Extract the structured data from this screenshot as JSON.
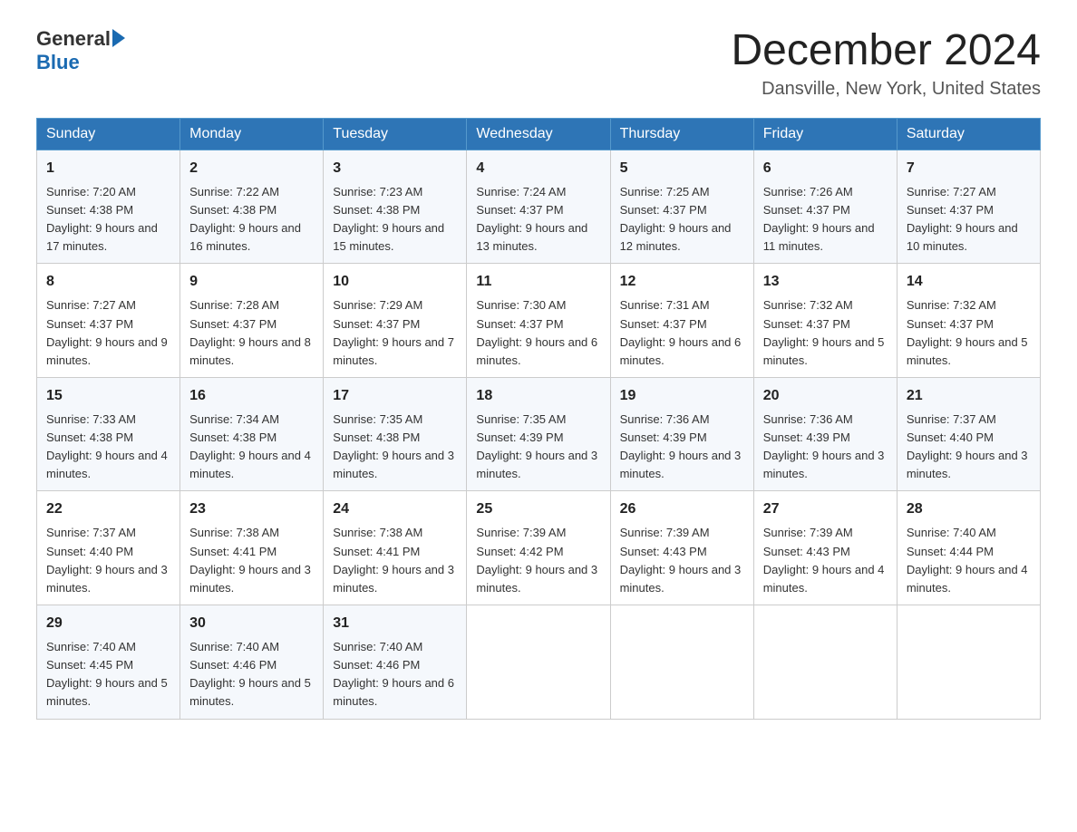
{
  "header": {
    "logo_general": "General",
    "logo_blue": "Blue",
    "month_title": "December 2024",
    "location": "Dansville, New York, United States"
  },
  "weekdays": [
    "Sunday",
    "Monday",
    "Tuesday",
    "Wednesday",
    "Thursday",
    "Friday",
    "Saturday"
  ],
  "weeks": [
    [
      {
        "day": "1",
        "sunrise": "7:20 AM",
        "sunset": "4:38 PM",
        "daylight": "9 hours and 17 minutes."
      },
      {
        "day": "2",
        "sunrise": "7:22 AM",
        "sunset": "4:38 PM",
        "daylight": "9 hours and 16 minutes."
      },
      {
        "day": "3",
        "sunrise": "7:23 AM",
        "sunset": "4:38 PM",
        "daylight": "9 hours and 15 minutes."
      },
      {
        "day": "4",
        "sunrise": "7:24 AM",
        "sunset": "4:37 PM",
        "daylight": "9 hours and 13 minutes."
      },
      {
        "day": "5",
        "sunrise": "7:25 AM",
        "sunset": "4:37 PM",
        "daylight": "9 hours and 12 minutes."
      },
      {
        "day": "6",
        "sunrise": "7:26 AM",
        "sunset": "4:37 PM",
        "daylight": "9 hours and 11 minutes."
      },
      {
        "day": "7",
        "sunrise": "7:27 AM",
        "sunset": "4:37 PM",
        "daylight": "9 hours and 10 minutes."
      }
    ],
    [
      {
        "day": "8",
        "sunrise": "7:27 AM",
        "sunset": "4:37 PM",
        "daylight": "9 hours and 9 minutes."
      },
      {
        "day": "9",
        "sunrise": "7:28 AM",
        "sunset": "4:37 PM",
        "daylight": "9 hours and 8 minutes."
      },
      {
        "day": "10",
        "sunrise": "7:29 AM",
        "sunset": "4:37 PM",
        "daylight": "9 hours and 7 minutes."
      },
      {
        "day": "11",
        "sunrise": "7:30 AM",
        "sunset": "4:37 PM",
        "daylight": "9 hours and 6 minutes."
      },
      {
        "day": "12",
        "sunrise": "7:31 AM",
        "sunset": "4:37 PM",
        "daylight": "9 hours and 6 minutes."
      },
      {
        "day": "13",
        "sunrise": "7:32 AM",
        "sunset": "4:37 PM",
        "daylight": "9 hours and 5 minutes."
      },
      {
        "day": "14",
        "sunrise": "7:32 AM",
        "sunset": "4:37 PM",
        "daylight": "9 hours and 5 minutes."
      }
    ],
    [
      {
        "day": "15",
        "sunrise": "7:33 AM",
        "sunset": "4:38 PM",
        "daylight": "9 hours and 4 minutes."
      },
      {
        "day": "16",
        "sunrise": "7:34 AM",
        "sunset": "4:38 PM",
        "daylight": "9 hours and 4 minutes."
      },
      {
        "day": "17",
        "sunrise": "7:35 AM",
        "sunset": "4:38 PM",
        "daylight": "9 hours and 3 minutes."
      },
      {
        "day": "18",
        "sunrise": "7:35 AM",
        "sunset": "4:39 PM",
        "daylight": "9 hours and 3 minutes."
      },
      {
        "day": "19",
        "sunrise": "7:36 AM",
        "sunset": "4:39 PM",
        "daylight": "9 hours and 3 minutes."
      },
      {
        "day": "20",
        "sunrise": "7:36 AM",
        "sunset": "4:39 PM",
        "daylight": "9 hours and 3 minutes."
      },
      {
        "day": "21",
        "sunrise": "7:37 AM",
        "sunset": "4:40 PM",
        "daylight": "9 hours and 3 minutes."
      }
    ],
    [
      {
        "day": "22",
        "sunrise": "7:37 AM",
        "sunset": "4:40 PM",
        "daylight": "9 hours and 3 minutes."
      },
      {
        "day": "23",
        "sunrise": "7:38 AM",
        "sunset": "4:41 PM",
        "daylight": "9 hours and 3 minutes."
      },
      {
        "day": "24",
        "sunrise": "7:38 AM",
        "sunset": "4:41 PM",
        "daylight": "9 hours and 3 minutes."
      },
      {
        "day": "25",
        "sunrise": "7:39 AM",
        "sunset": "4:42 PM",
        "daylight": "9 hours and 3 minutes."
      },
      {
        "day": "26",
        "sunrise": "7:39 AM",
        "sunset": "4:43 PM",
        "daylight": "9 hours and 3 minutes."
      },
      {
        "day": "27",
        "sunrise": "7:39 AM",
        "sunset": "4:43 PM",
        "daylight": "9 hours and 4 minutes."
      },
      {
        "day": "28",
        "sunrise": "7:40 AM",
        "sunset": "4:44 PM",
        "daylight": "9 hours and 4 minutes."
      }
    ],
    [
      {
        "day": "29",
        "sunrise": "7:40 AM",
        "sunset": "4:45 PM",
        "daylight": "9 hours and 5 minutes."
      },
      {
        "day": "30",
        "sunrise": "7:40 AM",
        "sunset": "4:46 PM",
        "daylight": "9 hours and 5 minutes."
      },
      {
        "day": "31",
        "sunrise": "7:40 AM",
        "sunset": "4:46 PM",
        "daylight": "9 hours and 6 minutes."
      },
      null,
      null,
      null,
      null
    ]
  ],
  "labels": {
    "sunrise": "Sunrise:",
    "sunset": "Sunset:",
    "daylight": "Daylight:"
  }
}
